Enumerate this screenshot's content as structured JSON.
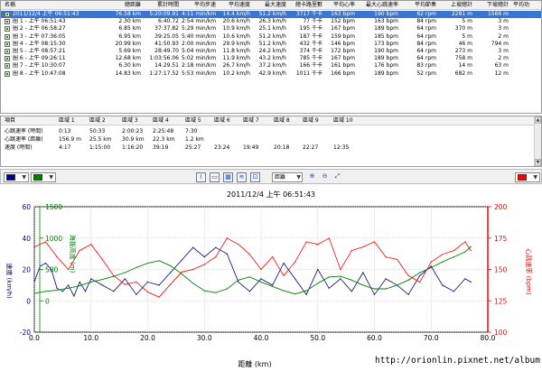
{
  "laps": {
    "headers": [
      "名稱",
      "總距離",
      "累計時間",
      "平均步速",
      "平均速度",
      "最大速度",
      "總卡路里數",
      "平均心率",
      "最大心跳速率",
      "平均節奏",
      "上坡總計",
      "下坡總計"
    ],
    "rows": [
      [
        "2011/12/4 上午 06:51:43",
        "76.58 km",
        "5:20:09.91",
        "4:11 min/km",
        "14.4 km/h",
        "51.2 km/h",
        "3717 千卡",
        "163 bpm",
        "190 bpm",
        "62 rpm",
        "2281 m",
        "1566 m"
      ],
      [
        "圈 1 - 上午 06:51:43",
        "2.30 km",
        "6:40.72",
        "2:54 min/km",
        "20.6 km/h",
        "26.3 km/h",
        "77 千卡",
        "152 bpm",
        "163 bpm",
        "84 rpm",
        "5 m",
        "3 m"
      ],
      [
        "圈 2 - 上午 06:58:27",
        "6.85 km",
        "37:37.82",
        "5:29 min/km",
        "10.9 km/h",
        "25.1 km/h",
        "195 千卡",
        "167 bpm",
        "189 bpm",
        "64 rpm",
        "370 m",
        "3 m"
      ],
      [
        "圈 3 - 上午 07:36:05",
        "6.95 km",
        "39:25.05",
        "5:40 min/km",
        "10.6 km/h",
        "51.2 km/h",
        "187 千卡",
        "159 bpm",
        "185 bpm",
        "64 rpm",
        "5 m",
        "2 m"
      ],
      [
        "圈 4 - 上午 08:15:30",
        "20.99 km",
        "41:50.93",
        "2:00 min/km",
        "29.9 km/h",
        "51.2 km/h",
        "432 千卡",
        "146 bpm",
        "173 bpm",
        "84 rpm",
        "46 m",
        "794 m"
      ],
      [
        "圈 5 - 上午 08:57:21",
        "5.69 km",
        "28:49.70",
        "5:04 min/km",
        "11.8 km/h",
        "24.2 km/h",
        "374 千卡",
        "172 bpm",
        "190 bpm",
        "64 rpm",
        "273 m",
        "3 m"
      ],
      [
        "圈 6 - 上午 09:26:11",
        "12.68 km",
        "1:03:56.06",
        "5:02 min/km",
        "11.9 km/h",
        "43.2 km/h",
        "785 千卡",
        "167 bpm",
        "189 bpm",
        "64 rpm",
        "758 m",
        "2 m"
      ],
      [
        "圈 7 - 上午 10:30:07",
        "6.30 km",
        "14:29.51",
        "2:18 min/km",
        "26.7 km/h",
        "37.2 km/h",
        "166 千卡",
        "161 bpm",
        "176 bpm",
        "83 rpm",
        "14 m",
        "63 m"
      ],
      [
        "圈 8 - 上午 10:47:08",
        "14.83 km",
        "1:27:17.52",
        "5:53 min/km",
        "10.2 km/h",
        "42.9 km/h",
        "1011 千卡",
        "166 bpm",
        "189 bpm",
        "52 rpm",
        "682 m",
        "12 m"
      ]
    ],
    "partial_next_header": "平均功"
  },
  "zones": {
    "headers": [
      "項目",
      "區域 1",
      "區域 2",
      "區域 3",
      "區域 4",
      "區域 5",
      "區域 6",
      "區域 7",
      "區域 8",
      "區域 9",
      "區域 10"
    ],
    "rows": [
      [
        "心跳速率 (時間)",
        "0:13",
        "50:33",
        "2:00:23",
        "2:25:48",
        "7:30",
        "",
        "",
        "",
        "",
        ""
      ],
      [
        "心跳速率 (距離)",
        "156.9 m",
        "25.5 km",
        "30.9 km",
        "22.3 km",
        "1.2 km",
        "",
        "",
        "",
        "",
        ""
      ],
      [
        "速度 (時間)",
        "4:17",
        "1:15:00",
        "1:16:20",
        "39:19",
        "25:27",
        "23:24",
        "19:49",
        "20:18",
        "22:27",
        "12:35"
      ]
    ]
  },
  "toolbar": {
    "left_color": "#00007f",
    "mid_color": "#008000",
    "right_color": "#ff0000",
    "select_value": "距離",
    "icons": [
      "line-chart-icon",
      "area-chart-icon",
      "grid-icon",
      "zoom-in-icon",
      "zoom-out-icon",
      "fit-icon"
    ]
  },
  "chart_data": {
    "type": "line",
    "title": "2011/12/4 上午 06:51:43",
    "xlabel": "距離 (km)",
    "ylabel_left": "速度 (km/h)",
    "ylabel_left2": "海拔高度 (m)",
    "ylabel_right": "心跳速率 (bpm)",
    "watermark": "http://orionlin.pixnet.net/album",
    "x_range": [
      0,
      80
    ],
    "x_ticks": [
      "0.0",
      "10.0",
      "20.0",
      "30.0",
      "40.0",
      "50.0",
      "60.0",
      "70.0",
      "80.0"
    ],
    "y_left_range": [
      -20,
      60
    ],
    "y_left_ticks": [
      "60",
      "40",
      "20",
      "0",
      "-20"
    ],
    "y_left2_range": [
      -500,
      1500
    ],
    "y_left2_ticks": [
      "1500",
      "1000",
      "500",
      "0"
    ],
    "y_right_range": [
      100,
      200
    ],
    "y_right_ticks": [
      "200",
      "175",
      "150",
      "125",
      "100"
    ],
    "grid": true,
    "series": [
      {
        "name": "速度",
        "axis": "left",
        "color": "#00007f",
        "x": [
          0,
          1,
          2,
          3,
          4,
          5,
          6,
          7,
          8,
          9,
          10,
          12,
          14,
          16,
          18,
          20,
          22,
          24,
          26,
          28,
          30,
          32,
          34,
          36,
          38,
          40,
          42,
          44,
          46,
          48,
          50,
          52,
          54,
          56,
          58,
          60,
          62,
          64,
          66,
          68,
          70,
          72,
          74,
          76,
          77
        ],
        "y": [
          12,
          22,
          24,
          20,
          8,
          6,
          10,
          3,
          12,
          6,
          14,
          10,
          6,
          14,
          4,
          12,
          10,
          18,
          26,
          34,
          28,
          34,
          30,
          12,
          6,
          14,
          10,
          24,
          14,
          4,
          20,
          8,
          14,
          6,
          18,
          4,
          14,
          10,
          4,
          16,
          22,
          10,
          6,
          14,
          12
        ]
      },
      {
        "name": "海拔高度",
        "axis": "left2",
        "color": "#008000",
        "x": [
          0,
          2,
          4,
          6,
          8,
          10,
          12,
          14,
          16,
          18,
          20,
          22,
          24,
          26,
          28,
          30,
          32,
          34,
          36,
          38,
          40,
          42,
          44,
          46,
          48,
          50,
          52,
          54,
          56,
          58,
          60,
          62,
          64,
          66,
          68,
          70,
          72,
          74,
          76,
          77
        ],
        "y": [
          120,
          150,
          170,
          200,
          240,
          300,
          340,
          390,
          450,
          530,
          600,
          640,
          560,
          430,
          280,
          160,
          130,
          190,
          330,
          380,
          300,
          230,
          160,
          110,
          160,
          280,
          380,
          390,
          330,
          250,
          190,
          190,
          250,
          330,
          450,
          530,
          620,
          700,
          780,
          860
        ]
      },
      {
        "name": "心跳速率",
        "axis": "right",
        "color": "#ff0000",
        "x": [
          0,
          2,
          4,
          6,
          8,
          10,
          12,
          14,
          16,
          18,
          20,
          22,
          24,
          26,
          28,
          30,
          32,
          34,
          36,
          38,
          40,
          42,
          44,
          46,
          48,
          50,
          52,
          54,
          56,
          58,
          60,
          62,
          64,
          66,
          68,
          70,
          72,
          74,
          76,
          77
        ],
        "y": [
          168,
          172,
          160,
          150,
          165,
          170,
          158,
          145,
          138,
          140,
          132,
          128,
          138,
          148,
          150,
          154,
          160,
          175,
          170,
          162,
          150,
          160,
          145,
          156,
          172,
          170,
          175,
          150,
          165,
          168,
          172,
          160,
          158,
          145,
          140,
          156,
          162,
          165,
          172,
          165
        ]
      }
    ]
  }
}
